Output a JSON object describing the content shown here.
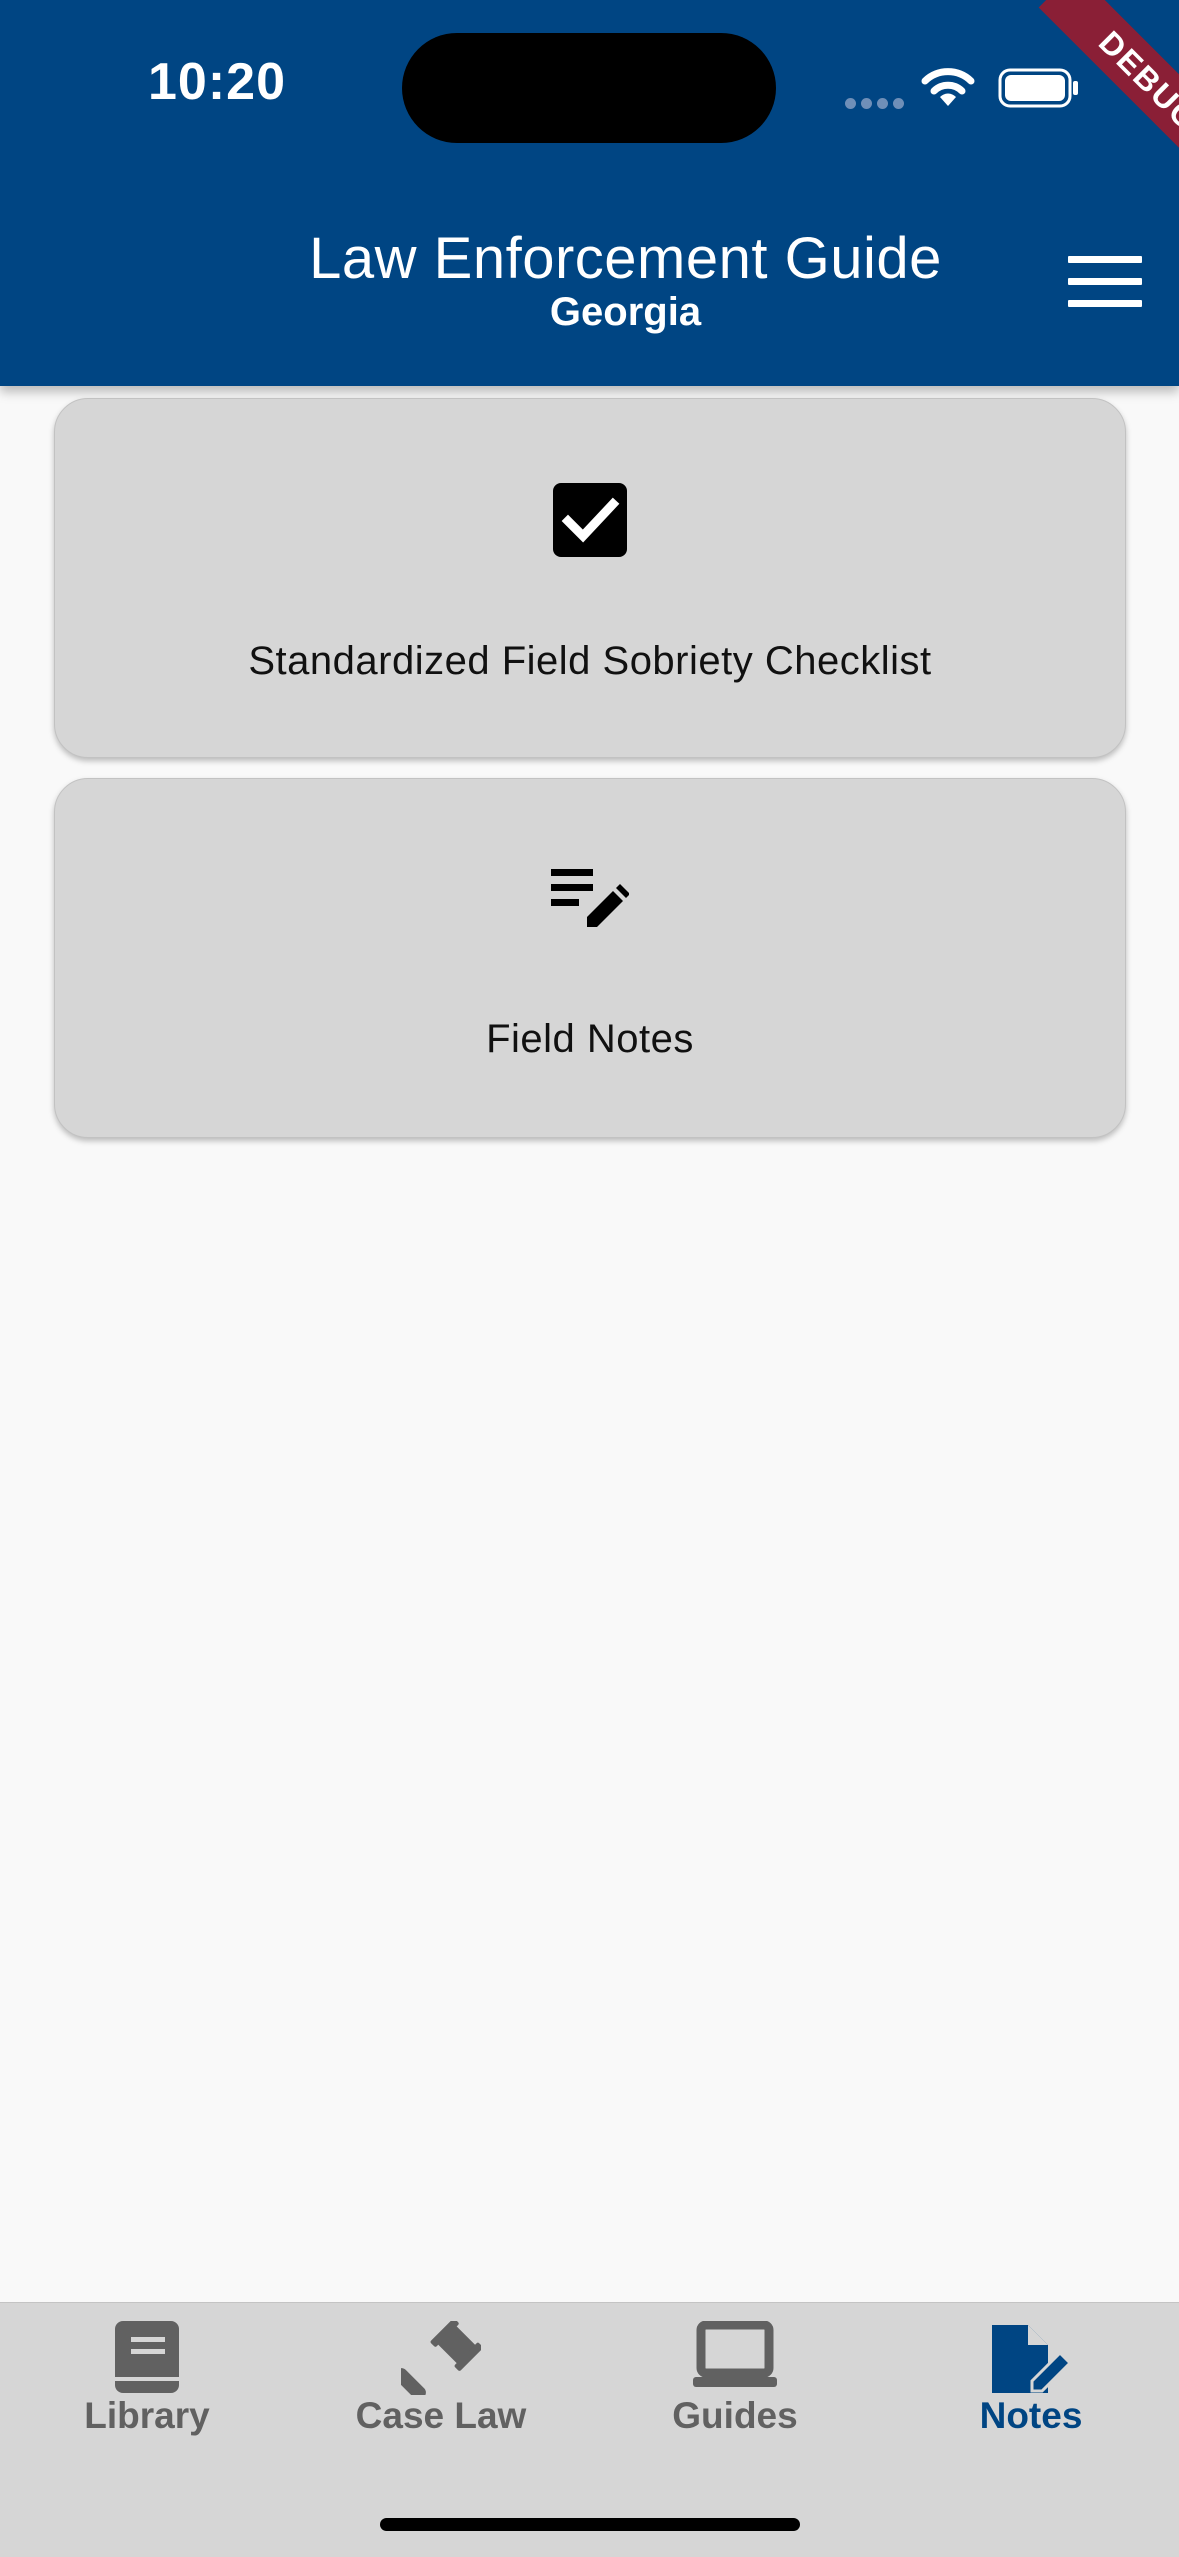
{
  "status_bar": {
    "time": "10:20"
  },
  "header": {
    "title": "Law Enforcement Guide",
    "subtitle": "Georgia",
    "debug_banner": "DEBUG"
  },
  "cards": [
    {
      "label": "Standardized Field Sobriety Checklist",
      "icon": "checkbox-checked-icon"
    },
    {
      "label": "Field Notes",
      "icon": "edit-note-icon"
    }
  ],
  "bottom_nav": {
    "items": [
      {
        "label": "Library",
        "icon": "book-icon"
      },
      {
        "label": "Case Law",
        "icon": "gavel-icon"
      },
      {
        "label": "Guides",
        "icon": "laptop-icon"
      },
      {
        "label": "Notes",
        "icon": "note-edit-icon",
        "active": true
      }
    ],
    "active_color": "#004583",
    "inactive_color": "#616161"
  },
  "colors": {
    "primary": "#004583",
    "card": "#d6d6d6",
    "background": "#f9f9f9"
  }
}
